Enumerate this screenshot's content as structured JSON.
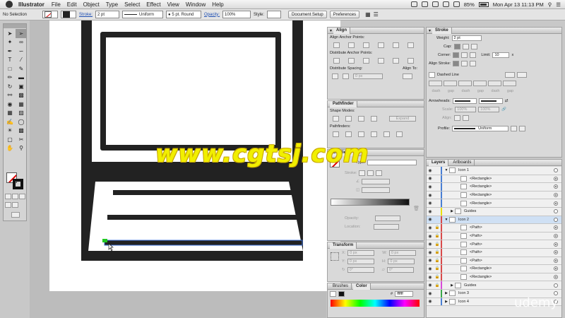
{
  "menubar": {
    "app_name": "Illustrator",
    "menus": [
      "File",
      "Edit",
      "Object",
      "Type",
      "Select",
      "Effect",
      "View",
      "Window",
      "Help"
    ],
    "battery": "85%",
    "datetime": "Mon Apr 13  11:13 PM"
  },
  "controlbar": {
    "selection": "No Selection",
    "stroke_label": "Stroke:",
    "stroke_weight": "2 pt",
    "profile": "Uniform",
    "brush": "5 pt. Round",
    "opacity_label": "Opacity:",
    "opacity": "100%",
    "style_label": "Style:",
    "doc_setup": "Document Setup",
    "preferences": "Preferences"
  },
  "align": {
    "title": "Align",
    "anchor_points": "Align Anchor Points:",
    "distribute_anchor": "Distribute Anchor Points:",
    "distribute_spacing": "Distribute Spacing:",
    "align_to": "Align To:",
    "spacing_value": "0 px"
  },
  "pathfinder": {
    "title": "Pathfinder",
    "shape_modes": "Shape Modes:",
    "expand": "Expand",
    "pathfinders": "Pathfinders:"
  },
  "gradient": {
    "title": "Gradient",
    "type_label": "Type:",
    "stroke_label": "Stroke:",
    "opacity_label": "Opacity:",
    "location_label": "Location:"
  },
  "transform": {
    "title": "Transform",
    "x_label": "X:",
    "x": "0 px",
    "y_label": "Y:",
    "y": "0 px",
    "w_label": "W:",
    "w": "0 px",
    "h_label": "H:",
    "h": "0 px",
    "rot": "0°",
    "shear": "0°"
  },
  "color": {
    "tab_brushes": "Brushes",
    "tab_color": "Color",
    "hex": "ffffff"
  },
  "stroke": {
    "title": "Stroke",
    "weight_label": "Weight:",
    "weight": "2 pt",
    "cap_label": "Cap:",
    "corner_label": "Corner:",
    "limit_label": "Limit:",
    "limit": "10",
    "limit_x": "x",
    "align_label": "Align Stroke:",
    "dashed": "Dashed Line",
    "dash_labels": [
      "dash",
      "gap",
      "dash",
      "gap",
      "dash",
      "gap"
    ],
    "arrowheads": "Arrowheads:",
    "scale_label": "Scale:",
    "scale1": "100%",
    "scale2": "100%",
    "align2_label": "Align:",
    "profile_label": "Profile:",
    "profile": "Uniform"
  },
  "layers": {
    "tab_layers": "Layers",
    "tab_artboards": "Artboards",
    "rows": [
      {
        "name": "Icon 1",
        "indent": 0,
        "color": "#4a7fd4",
        "sel": false,
        "tri": "open"
      },
      {
        "name": "<Rectangle>",
        "indent": 2,
        "color": "#4a7fd4",
        "sel": false,
        "tri": ""
      },
      {
        "name": "<Rectangle>",
        "indent": 2,
        "color": "#4a7fd4",
        "sel": false,
        "tri": ""
      },
      {
        "name": "<Rectangle>",
        "indent": 2,
        "color": "#4a7fd4",
        "sel": false,
        "tri": ""
      },
      {
        "name": "<Rectangle>",
        "indent": 2,
        "color": "#4a7fd4",
        "sel": false,
        "tri": ""
      },
      {
        "name": "Guides",
        "indent": 1,
        "color": "#e8e000",
        "sel": false,
        "tri": "closed"
      },
      {
        "name": "Icon 2",
        "indent": 0,
        "color": "#d84a4a",
        "sel": true,
        "tri": "open"
      },
      {
        "name": "<Path>",
        "indent": 2,
        "color": "#d84a4a",
        "sel": false,
        "tri": ""
      },
      {
        "name": "<Path>",
        "indent": 2,
        "color": "#d84a4a",
        "sel": false,
        "tri": ""
      },
      {
        "name": "<Path>",
        "indent": 2,
        "color": "#d84a4a",
        "sel": false,
        "tri": ""
      },
      {
        "name": "<Path>",
        "indent": 2,
        "color": "#d84a4a",
        "sel": false,
        "tri": ""
      },
      {
        "name": "<Path>",
        "indent": 2,
        "color": "#d84a4a",
        "sel": false,
        "tri": ""
      },
      {
        "name": "<Rectangle>",
        "indent": 2,
        "color": "#d84a4a",
        "sel": false,
        "tri": ""
      },
      {
        "name": "<Rectangle>",
        "indent": 2,
        "color": "#d84a4a",
        "sel": false,
        "tri": ""
      },
      {
        "name": "Guides",
        "indent": 1,
        "color": "#d84ad8",
        "sel": false,
        "tri": "closed"
      },
      {
        "name": "Icon 3",
        "indent": 0,
        "color": "#3aa84a",
        "sel": false,
        "tri": "closed"
      },
      {
        "name": "Icon 4",
        "indent": 0,
        "color": "#4a7fd4",
        "sel": false,
        "tri": "closed"
      }
    ]
  },
  "watermark": "www.cgtsj.com",
  "udemy": "udemy",
  "tools": [
    "select",
    "direct-select",
    "magic-wand",
    "lasso",
    "pen",
    "curvature",
    "type",
    "line",
    "rectangle",
    "paintbrush",
    "pencil",
    "eraser",
    "rotate",
    "scale",
    "warp",
    "free-transform",
    "shape-builder",
    "perspective",
    "mesh",
    "gradient",
    "eyedropper",
    "blend",
    "symbol-sprayer",
    "column-graph",
    "artboard",
    "slice",
    "hand",
    "zoom"
  ]
}
